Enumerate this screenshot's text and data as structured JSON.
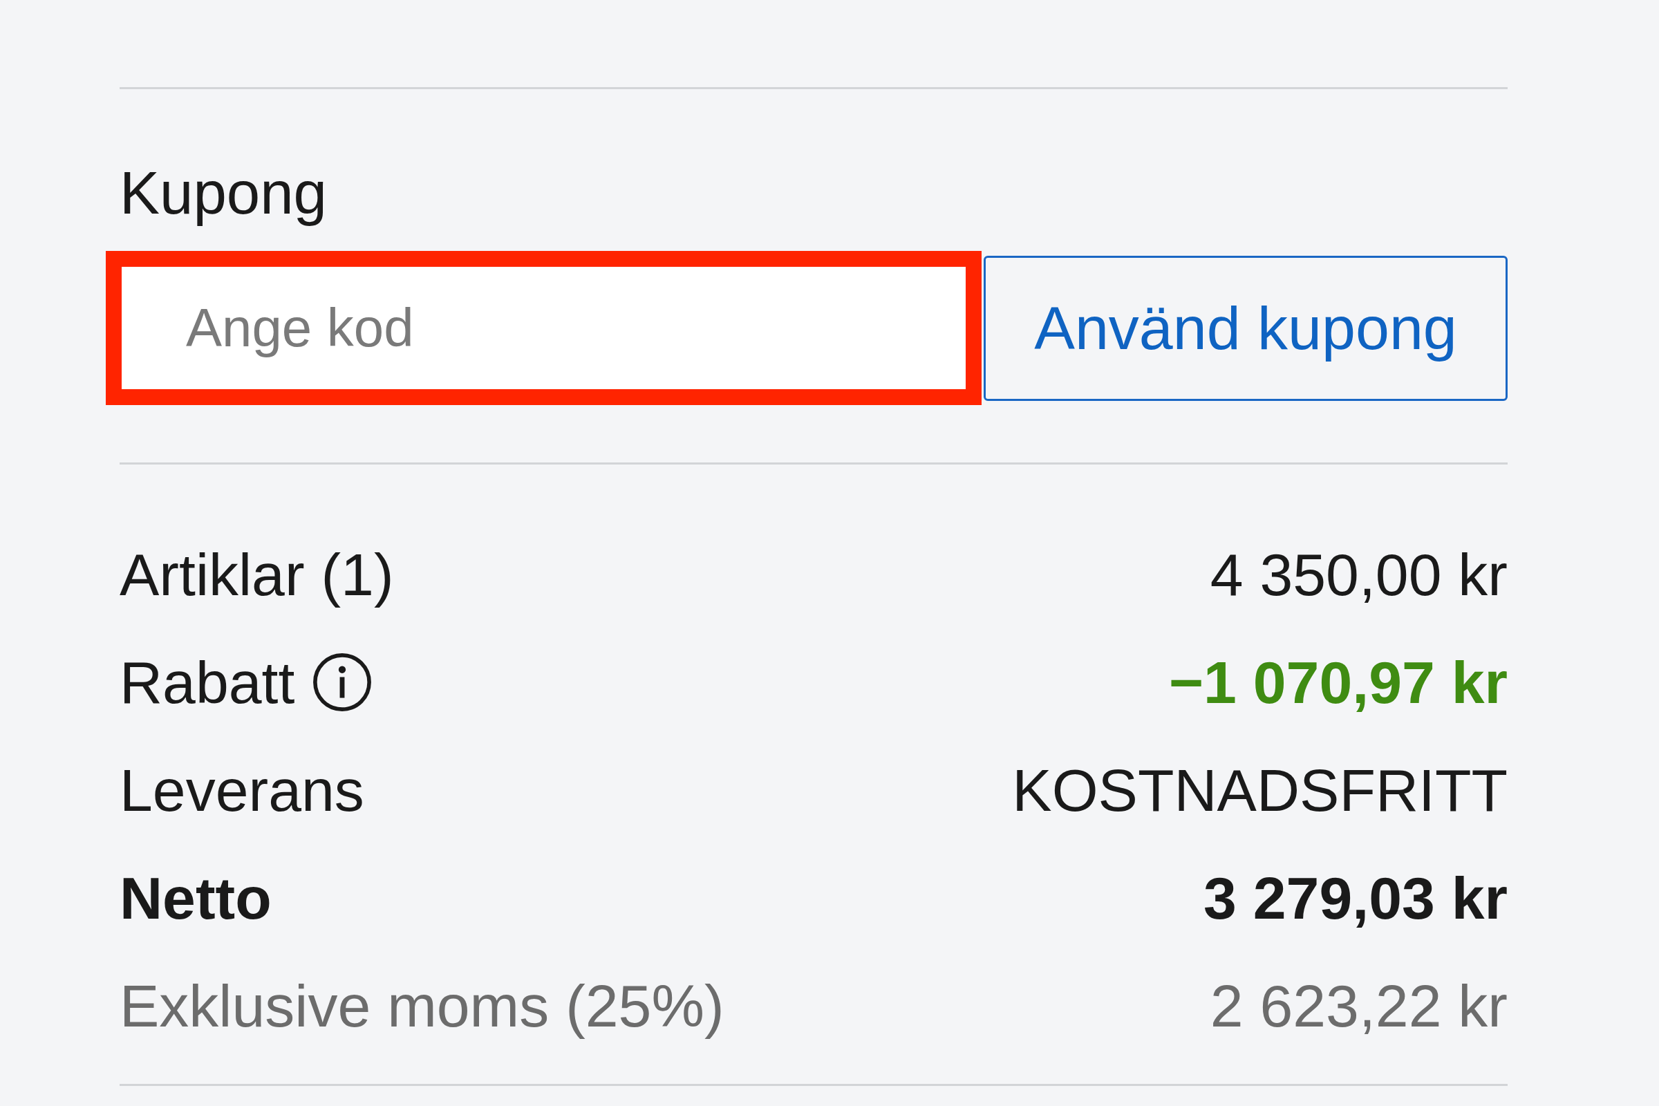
{
  "coupon": {
    "label": "Kupong",
    "input": {
      "placeholder": "Ange kod",
      "highlighted": true
    },
    "button": "Använd kupong"
  },
  "summary": [
    {
      "kind": "normal",
      "label": "Artiklar (1)",
      "info": false,
      "value": "4 350,00 kr"
    },
    {
      "kind": "discount",
      "label": "Rabatt",
      "info": true,
      "value": "−1 070,97 kr"
    },
    {
      "kind": "normal",
      "label": "Leverans",
      "info": false,
      "value": "KOSTNADSFRITT"
    },
    {
      "kind": "total",
      "label": "Netto",
      "info": false,
      "value": "3 279,03 kr"
    },
    {
      "kind": "note",
      "label": "Exklusive moms (25%)",
      "info": false,
      "value": "2 623,22 kr"
    }
  ]
}
